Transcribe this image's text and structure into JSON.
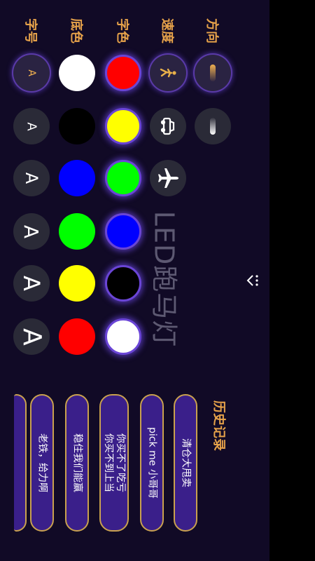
{
  "headers": {
    "font_size": "字号",
    "bg_color": "底色",
    "text_color": "字色",
    "speed": "速度",
    "direction": "方向"
  },
  "font_sizes": [
    "A",
    "A",
    "A",
    "A",
    "A",
    "A"
  ],
  "bg_colors": [
    "#ffffff",
    "#000000",
    "#0000ff",
    "#00ff00",
    "#ffff00",
    "#ff0000"
  ],
  "text_colors": [
    "#ff0000",
    "#ffff00",
    "#00ff00",
    "#0000ff",
    "#000000",
    "#ffffff"
  ],
  "speed_icons": [
    "walking-person-icon",
    "car-icon",
    "airplane-icon"
  ],
  "direction_icons": [
    "direction-up-icon",
    "direction-down-icon"
  ],
  "watermark": "LED跑马灯",
  "history": {
    "title": "历史记录",
    "items": [
      "清仓大甩卖",
      "pick me 小哥哥",
      "你买不了吃亏\n你买不到上当",
      "稳住我们能赢",
      "老铁，给力啊",
      ""
    ]
  },
  "accent": "#e6a24a",
  "pill_bg": "#3a1f8a",
  "pill_border": "#c9a14f",
  "selection_glow": "#6a45d6"
}
